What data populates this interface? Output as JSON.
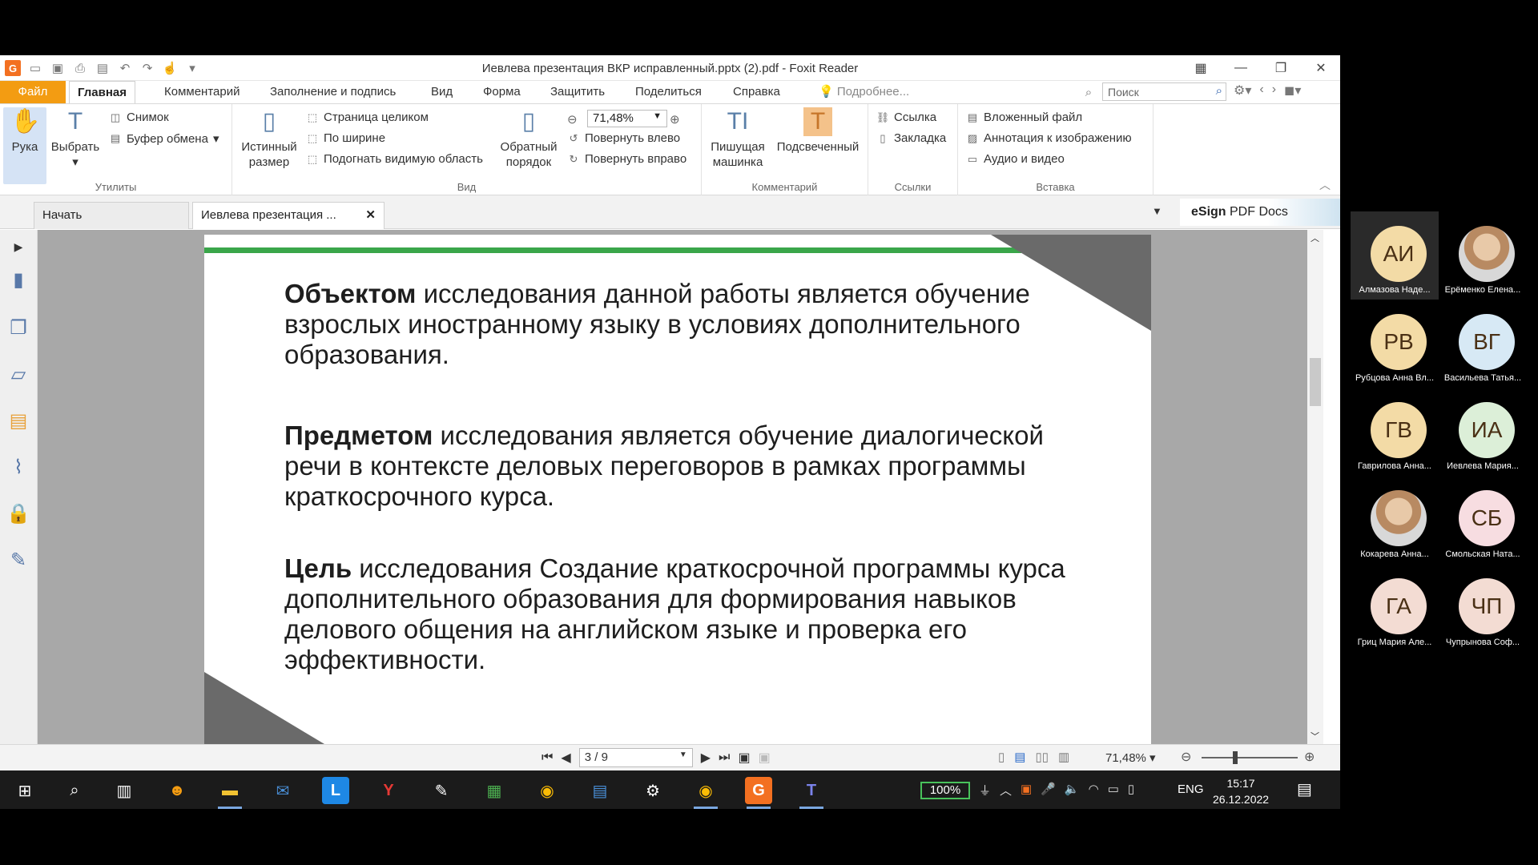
{
  "window": {
    "title": "Иевлева  презентация ВКР исправленный.pptx (2).pdf - Foxit Reader",
    "controls": [
      "minimize-icon",
      "restore-icon",
      "close-icon"
    ]
  },
  "ribbon_tabs": [
    "Файл",
    "Главная",
    "Комментарий",
    "Заполнение и подпись",
    "Вид",
    "Форма",
    "Защитить",
    "Поделиться",
    "Справка",
    "Подробнее..."
  ],
  "active_tab": "Главная",
  "search": {
    "placeholder": "Поиск"
  },
  "ribbon": {
    "hand": "Рука",
    "select": "Выбрать",
    "snapshot": "Снимок",
    "clipboard": "Буфер обмена",
    "group_utilities": "Утилиты",
    "actual_size_line1": "Истинный",
    "actual_size_line2": "размер",
    "fit_page": "Страница целиком",
    "fit_width": "По ширине",
    "fit_visible": "Подогнать видимую область",
    "zoom_value": "71,48%",
    "reverse_line1": "Обратный",
    "reverse_line2": "порядок",
    "rotate_left": "Повернуть влево",
    "rotate_right": "Повернуть вправо",
    "group_view": "Вид",
    "typewriter_line1": "Пишущая",
    "typewriter_line2": "машинка",
    "highlight": "Подсвеченный",
    "group_comment": "Комментарий",
    "link": "Ссылка",
    "bookmark": "Закладка",
    "group_links": "Ссылки",
    "attachment": "Вложенный файл",
    "image_annotation": "Аннотация к изображению",
    "audio_video": "Аудио и видео",
    "group_insert": "Вставка"
  },
  "doc_tabs": [
    "Начать",
    "Иевлева  презентация ..."
  ],
  "esign": {
    "brand": "eSign",
    "rest": " PDF Docs"
  },
  "slide": {
    "p1_bold": "Объектом",
    "p1_rest": " исследования данной работы является обучение взрослых иностранному языку в условиях дополнительного образования.",
    "p2_bold": "Предметом",
    "p2_rest": " исследования является обучение диалогической речи в контексте деловых переговоров в рамках программы краткосрочного курса.",
    "p3_bold": "Цель",
    "p3_rest": " исследования Создание краткосрочной  программы курса дополнительного образования  для  формирования навыков   делового  общения на  английском  языке  и проверка его эффективности."
  },
  "status": {
    "page": "3 / 9",
    "zoom": "71,48%"
  },
  "taskbar": {
    "battery": "100%",
    "lang": "ENG",
    "time": "15:17",
    "date": "26.12.2022"
  },
  "participants": [
    {
      "initials": "АИ",
      "name": "Алмазова Наде...",
      "color": "#f3dba6",
      "photo": false
    },
    {
      "initials": "",
      "name": "Ерёменко Елена...",
      "color": "#ddd",
      "photo": true
    },
    {
      "initials": "РВ",
      "name": "Рубцова Анна Вл...",
      "color": "#f3dba6",
      "photo": false
    },
    {
      "initials": "ВГ",
      "name": "Васильева Татья...",
      "color": "#d7e9f5",
      "photo": false
    },
    {
      "initials": "ГВ",
      "name": "Гаврилова Анна...",
      "color": "#f3dba6",
      "photo": false
    },
    {
      "initials": "ИА",
      "name": "Иевлева Мария...",
      "color": "#dcefd8",
      "photo": false
    },
    {
      "initials": "",
      "name": "Кокарева Анна...",
      "color": "#ddd",
      "photo": true
    },
    {
      "initials": "СБ",
      "name": "Смольская Ната...",
      "color": "#f7dde1",
      "photo": false
    },
    {
      "initials": "ГА",
      "name": "Гриц Мария Але...",
      "color": "#f3dcd3",
      "photo": false
    },
    {
      "initials": "ЧП",
      "name": "Чупрынова Соф...",
      "color": "#f3dcd3",
      "photo": false
    }
  ]
}
